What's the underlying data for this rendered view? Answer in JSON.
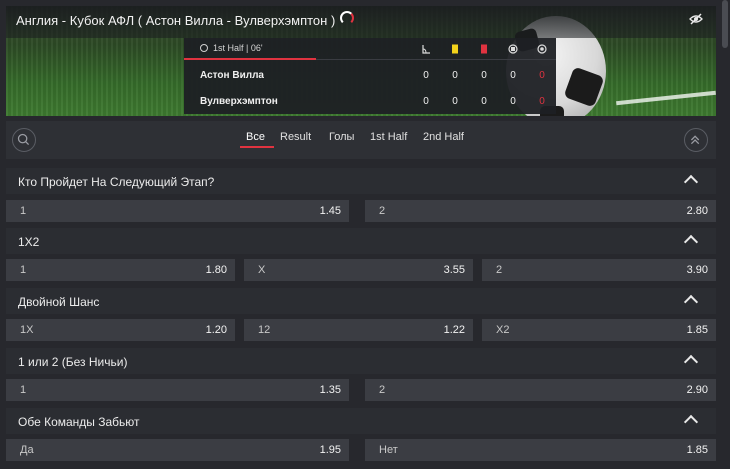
{
  "header": {
    "match_title": "Англия - Кубок АФЛ ( Астон Вилла - Вулверхэмптон )"
  },
  "scoreboard": {
    "period_time": "1st Half | 06'",
    "stat_icons": [
      "corner-flag-icon",
      "yellow-card-icon",
      "red-card-icon",
      "penalty-icon",
      "ball-icon"
    ],
    "teams": [
      {
        "name": "Астон Вилла",
        "stats": [
          "0",
          "0",
          "0",
          "0",
          "0"
        ]
      },
      {
        "name": "Вулверхэмптон",
        "stats": [
          "0",
          "0",
          "0",
          "0",
          "0"
        ]
      }
    ]
  },
  "tabs": [
    "Все",
    "Result",
    "Голы",
    "1st Half",
    "2nd Half"
  ],
  "markets": [
    {
      "title": "Кто Пройдет На Следующий Этап?",
      "odds": [
        {
          "label": "1",
          "price": "1.45"
        },
        {
          "label": "2",
          "price": "2.80"
        }
      ]
    },
    {
      "title": "1X2",
      "odds": [
        {
          "label": "1",
          "price": "1.80"
        },
        {
          "label": "X",
          "price": "3.55"
        },
        {
          "label": "2",
          "price": "3.90"
        }
      ]
    },
    {
      "title": "Двойной Шанс",
      "odds": [
        {
          "label": "1X",
          "price": "1.20"
        },
        {
          "label": "12",
          "price": "1.22"
        },
        {
          "label": "X2",
          "price": "1.85"
        }
      ]
    },
    {
      "title": "1 или 2 (Без Ничьи)",
      "odds": [
        {
          "label": "1",
          "price": "1.35"
        },
        {
          "label": "2",
          "price": "2.90"
        }
      ]
    },
    {
      "title": "Обе Команды Забьют",
      "odds": [
        {
          "label": "Да",
          "price": "1.95"
        },
        {
          "label": "Нет",
          "price": "1.85"
        }
      ]
    }
  ],
  "colors": {
    "accent": "#e03340",
    "background": "#27282d",
    "row_bg": "#3b3d43",
    "header_bg": "#2b2d32",
    "yellow_card": "#f2d21b",
    "red_card": "#e03340"
  }
}
